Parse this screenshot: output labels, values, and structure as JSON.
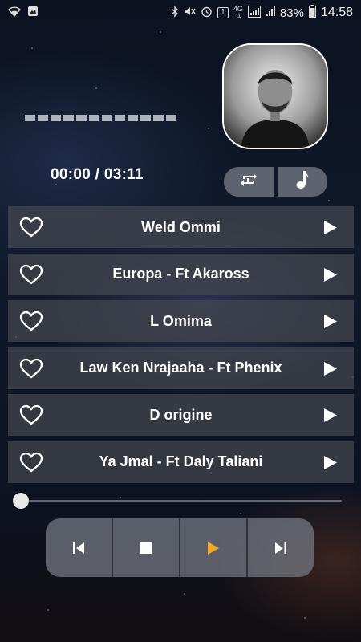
{
  "status_bar": {
    "network": "4G",
    "sim": "1",
    "battery_percent": "83%",
    "time": "14:58",
    "icons": [
      "wifi-icon",
      "bluetooth-icon",
      "mute-icon",
      "alarm-icon",
      "sim-icon",
      "signal-icon",
      "battery-icon"
    ]
  },
  "player": {
    "time_display": "00:00 / 03:11",
    "progress": 0.0,
    "accent_color": "#f5a623",
    "controls": {
      "repeat": "repeat-icon",
      "playlist": "music-note-icon",
      "previous": "skip-previous-icon",
      "stop": "stop-icon",
      "play": "play-icon",
      "next": "skip-next-icon"
    }
  },
  "songs": [
    {
      "title": "Weld Ommi"
    },
    {
      "title": "Europa - Ft Akaross"
    },
    {
      "title": "L Omima"
    },
    {
      "title": "Law Ken Nrajaaha - Ft Phenix"
    },
    {
      "title": "D origine"
    },
    {
      "title": "Ya Jmal - Ft Daly Taliani"
    }
  ]
}
